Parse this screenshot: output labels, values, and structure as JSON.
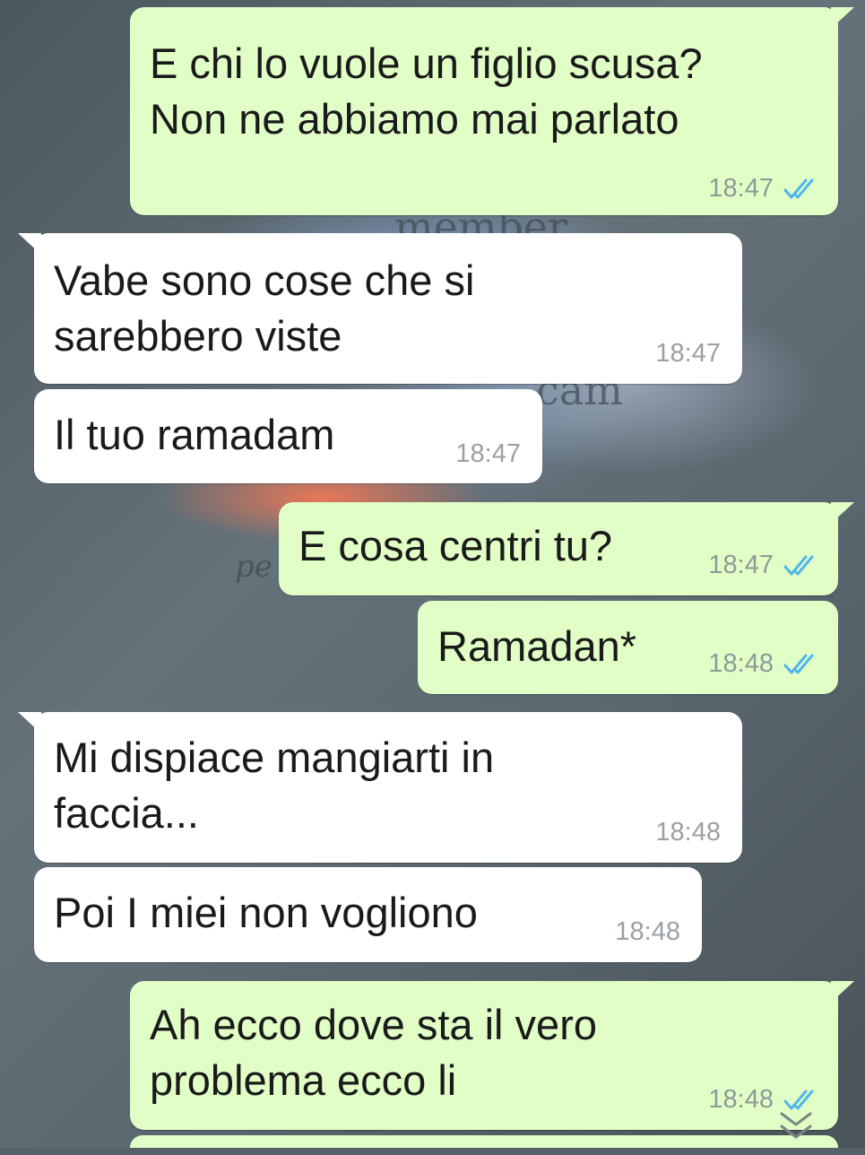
{
  "messages": [
    {
      "direction": "out",
      "text": "E chi lo vuole un figlio scusa?\nNon ne abbiamo mai parlato",
      "time": "18:47",
      "status": "read"
    },
    {
      "direction": "in",
      "text": "Vabe sono cose che si\nsarebbero viste",
      "time": "18:47"
    },
    {
      "direction": "in",
      "text": "Il tuo ramadam",
      "time": "18:47"
    },
    {
      "direction": "out",
      "text": "E cosa centri tu?",
      "time": "18:47",
      "status": "read"
    },
    {
      "direction": "out",
      "text": "Ramadan*",
      "time": "18:48",
      "status": "read"
    },
    {
      "direction": "in",
      "text": "Mi dispiace mangiarti in\nfaccia...",
      "time": "18:48"
    },
    {
      "direction": "in",
      "text": "Poi I miei non vogliono",
      "time": "18:48"
    },
    {
      "direction": "out",
      "text": "Ah ecco dove sta il vero\nproblema ecco li",
      "time": "18:48",
      "status": "read"
    }
  ],
  "colors": {
    "outgoing_bubble": "#e1fec6",
    "incoming_bubble": "#ffffff",
    "read_ticks": "#4fb6ec",
    "timestamp": "#8e9a98"
  },
  "icons": {
    "read_receipt": "double-check-icon",
    "scroll_down": "double-chevron-down-icon"
  }
}
